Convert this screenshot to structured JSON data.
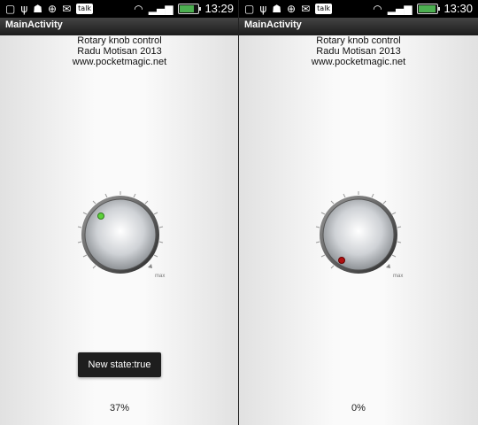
{
  "screens": [
    {
      "status": {
        "time": "13:29",
        "battery_level": 0.7,
        "notification_icons": [
          "talk-icon"
        ]
      },
      "app_title": "MainActivity",
      "header": {
        "line1": "Rotary knob control",
        "line2": "Radu Motisan 2013",
        "line3": "www.pocketmagic.net"
      },
      "knob": {
        "indicator": "green",
        "max_label": "max"
      },
      "toast": "New state:true",
      "percent": "37%"
    },
    {
      "status": {
        "time": "13:30",
        "battery_level": 0.85,
        "notification_icons": [
          "talk-icon"
        ]
      },
      "app_title": "MainActivity",
      "header": {
        "line1": "Rotary knob control",
        "line2": "Radu Motisan 2013",
        "line3": "www.pocketmagic.net"
      },
      "knob": {
        "indicator": "red",
        "max_label": "max"
      },
      "percent": "0%"
    }
  ],
  "colors": {
    "green_indicator": "#5cd13a",
    "red_indicator": "#b01010",
    "battery": "#4caf50"
  }
}
